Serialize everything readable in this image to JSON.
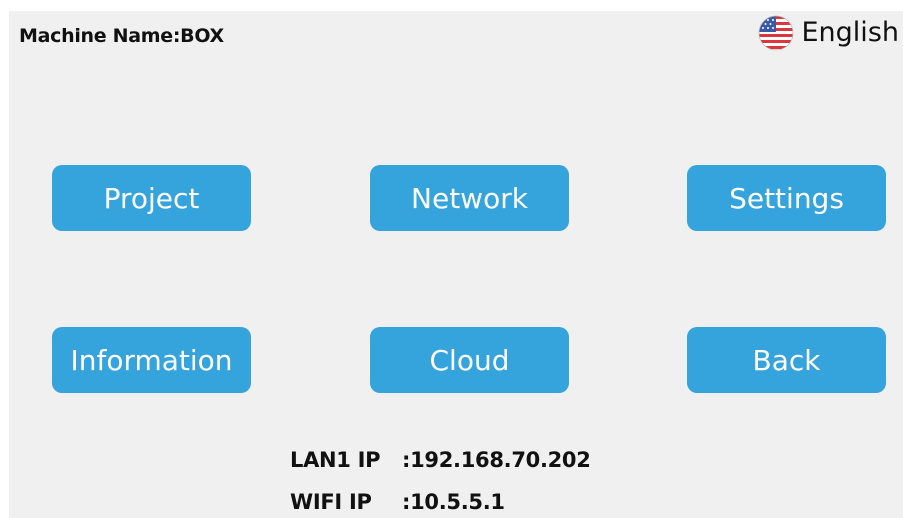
{
  "header": {
    "machine_label": "Machine Name:",
    "machine_name": "BOX",
    "language": {
      "label": "English",
      "flag_icon": "us-flag-icon"
    }
  },
  "menu": {
    "buttons": [
      {
        "label": "Project"
      },
      {
        "label": "Network"
      },
      {
        "label": "Settings"
      },
      {
        "label": "Information"
      },
      {
        "label": "Cloud"
      },
      {
        "label": "Back"
      }
    ]
  },
  "status": {
    "lan1": {
      "label": "LAN1 IP",
      "value": ":192.168.70.202"
    },
    "wifi": {
      "label": "WIFI IP",
      "value": ":10.5.5.1"
    }
  },
  "colors": {
    "background": "#f0f0f0",
    "button": "#35a3dc",
    "button_text": "#ffffff",
    "text": "#111111"
  }
}
